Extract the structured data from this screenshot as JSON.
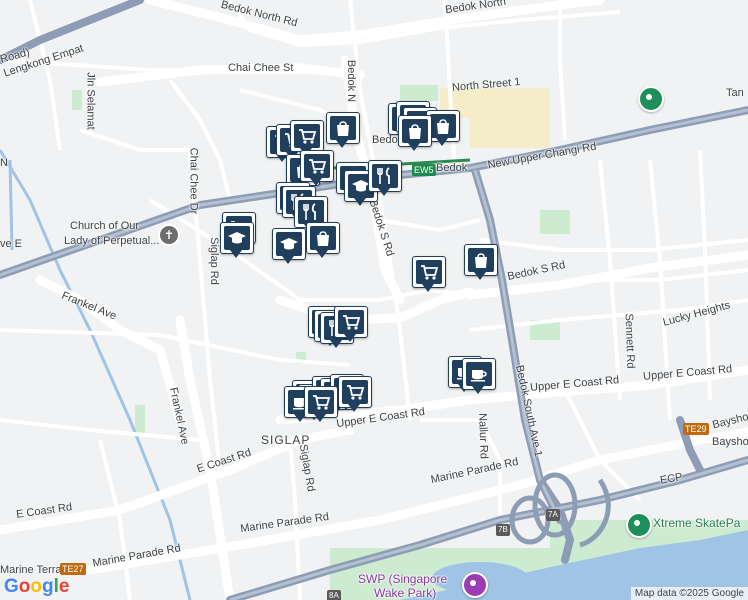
{
  "map": {
    "roads": {
      "bedok_north_rd": "Bedok North Rd",
      "bedok_north_top": "Bedok North",
      "chai_chee_st": "Chai Chee St",
      "bedok_north_st1": "North Street 1",
      "new_upper_changi_rd": "New Upper Changi Rd",
      "bedok_s_rd": "Bedok S Rd",
      "bedok_s_rd_vert": "Bedok S Rd",
      "bedok_north_ave_vert": "Bedok N",
      "chai_chee_dr": "Chai Chee Dr",
      "siglap_rd": "Siglap Rd",
      "jln_selamat": "Jln Selamat",
      "lengkong_empat": "Lengkong Empat",
      "frankel_ave": "Frankel Ave",
      "frankel_ave_vert": "Frankel Ave",
      "upper_e_coast_rd": "Upper E Coast Rd",
      "upper_e_coast_rd_right": "Upper E Coast Rd",
      "upper_e_coast_rd_left": "Upper E Coast Rd",
      "e_coast_rd": "E Coast Rd",
      "e_coast_rd_left": "E Coast Rd",
      "marine_parade_rd": "Marine Parade Rd",
      "marine_parade_rd_left": "Marine Parade Rd",
      "marine_parade_rd_mid": "Marine Parade Rd",
      "nallur_rd": "Nallur Rd",
      "bedok_south_ave1": "Bedok South Ave 1",
      "sennett_rd": "Sennett Rd",
      "lucky_heights": "Lucky Heights",
      "bayshore_rd": "Bayshore",
      "ecp": "ECP",
      "tan": "Tan",
      "we_e": "ve E",
      "roand": "Road)",
      "marine_terrace": "Marine Terrace",
      "edge_n": "N",
      "bedok_mrt_partial": "Bedok"
    },
    "places": {
      "church_line1": "Church of Our",
      "church_line2": "Lady of Perpetual...",
      "siglap": "SIGLAP",
      "bayshore": "Bayshore",
      "xtreme": "Xtreme SkatePa",
      "swp_line1": "SWP (Singapore",
      "swp_line2": "Wake Park)"
    },
    "stations": {
      "ew5": "EW5",
      "bedok": "Bedok",
      "te29": "TE29",
      "te27": "TE27"
    },
    "road_shields": {
      "r7b": "7B",
      "r7a": "7A",
      "r8a": "8A"
    },
    "footer": {
      "google": "Google",
      "attribution": "Map data ©2025 Google"
    },
    "colors": {
      "expressway": "#8c9db5",
      "major_road": "#ffffff",
      "water": "#9fc4e6",
      "park": "#cdebd1",
      "poi_marker": "#1f3f5c"
    }
  }
}
